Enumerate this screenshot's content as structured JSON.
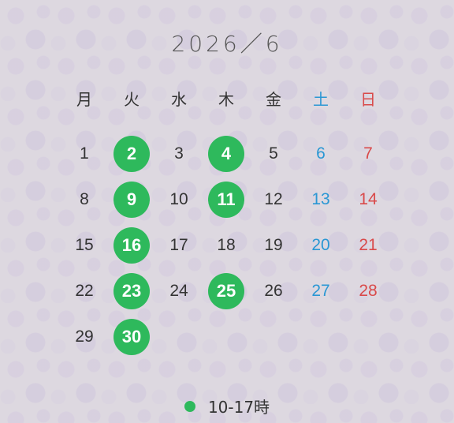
{
  "calendar": {
    "title": "2026／6",
    "weekdays": [
      "月",
      "火",
      "水",
      "木",
      "金",
      "土",
      "日"
    ],
    "weeks": [
      [
        "1",
        "2",
        "3",
        "4",
        "5",
        "6",
        "7"
      ],
      [
        "8",
        "9",
        "10",
        "11",
        "12",
        "13",
        "14"
      ],
      [
        "15",
        "16",
        "17",
        "18",
        "19",
        "20",
        "21"
      ],
      [
        "22",
        "23",
        "24",
        "25",
        "26",
        "27",
        "28"
      ],
      [
        "29",
        "30",
        "",
        "",
        "",
        "",
        ""
      ]
    ],
    "marked_days": [
      "2",
      "4",
      "9",
      "11",
      "16",
      "23",
      "25",
      "30"
    ]
  },
  "legend": {
    "label": "10-17時"
  },
  "colors": {
    "marker": "#2eb95c",
    "saturday": "#2a97d4",
    "sunday": "#d94a4a",
    "text": "#333333"
  }
}
